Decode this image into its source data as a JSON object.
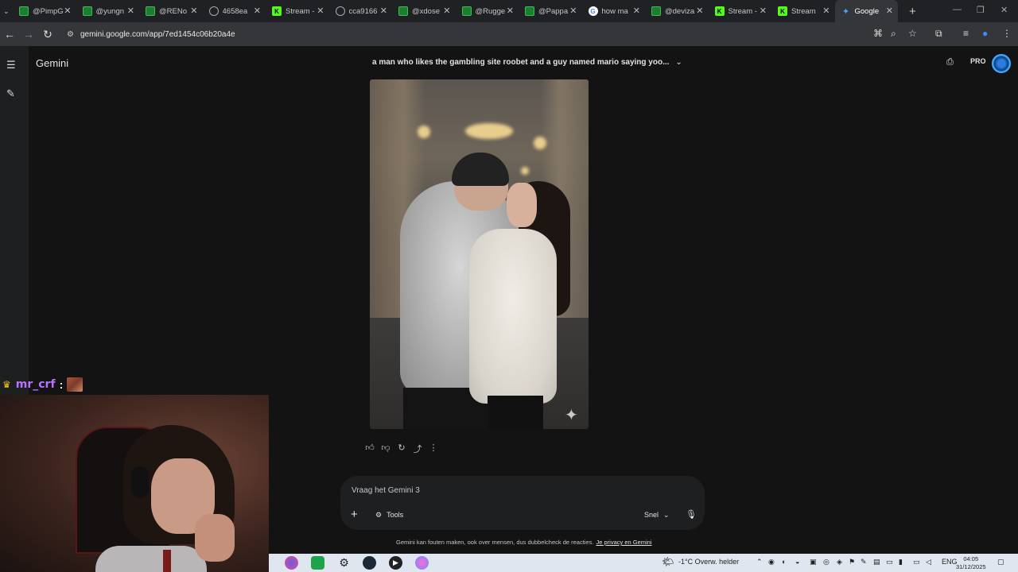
{
  "browser": {
    "tabs": [
      {
        "title": "@PimpG",
        "icon": "terminal-icon"
      },
      {
        "title": "@yungn",
        "icon": "terminal-icon"
      },
      {
        "title": "@RENo",
        "icon": "terminal-icon"
      },
      {
        "title": "4658ea",
        "icon": "globe-icon"
      },
      {
        "title": "Stream -",
        "icon": "kick-icon"
      },
      {
        "title": "cca9166",
        "icon": "globe-icon"
      },
      {
        "title": "@xdose",
        "icon": "terminal-icon"
      },
      {
        "title": "@Rugge",
        "icon": "terminal-icon"
      },
      {
        "title": "@Pappa",
        "icon": "terminal-icon"
      },
      {
        "title": "how ma",
        "icon": "google-icon"
      },
      {
        "title": "@deviza",
        "icon": "terminal-icon"
      },
      {
        "title": "Stream -",
        "icon": "kick-icon"
      },
      {
        "title": "Stream",
        "icon": "kick-icon"
      },
      {
        "title": "Google",
        "icon": "gemini-icon"
      }
    ],
    "url": "gemini.google.com/app/7ed1454c06b20a4e"
  },
  "app": {
    "brand": "Gemini",
    "conversation_title": "a man who likes the gambling site roobet and a guy named mario saying yoo...",
    "pro_label": "PRO"
  },
  "composer": {
    "placeholder": "Vraag het Gemini 3",
    "tools_label": "Tools",
    "mode_label": "Snel"
  },
  "disclaimer": {
    "text": "Gemini kan fouten maken, ook over mensen, dus dubbelcheck de reacties.",
    "link": "Je privacy en Gemini"
  },
  "stream_overlay": {
    "username": "mr_crf",
    "separator": ":"
  },
  "taskbar": {
    "weather": "-1°C  Overw. helder",
    "language": "ENG",
    "time": "04:05",
    "date": "31/12/2025"
  }
}
